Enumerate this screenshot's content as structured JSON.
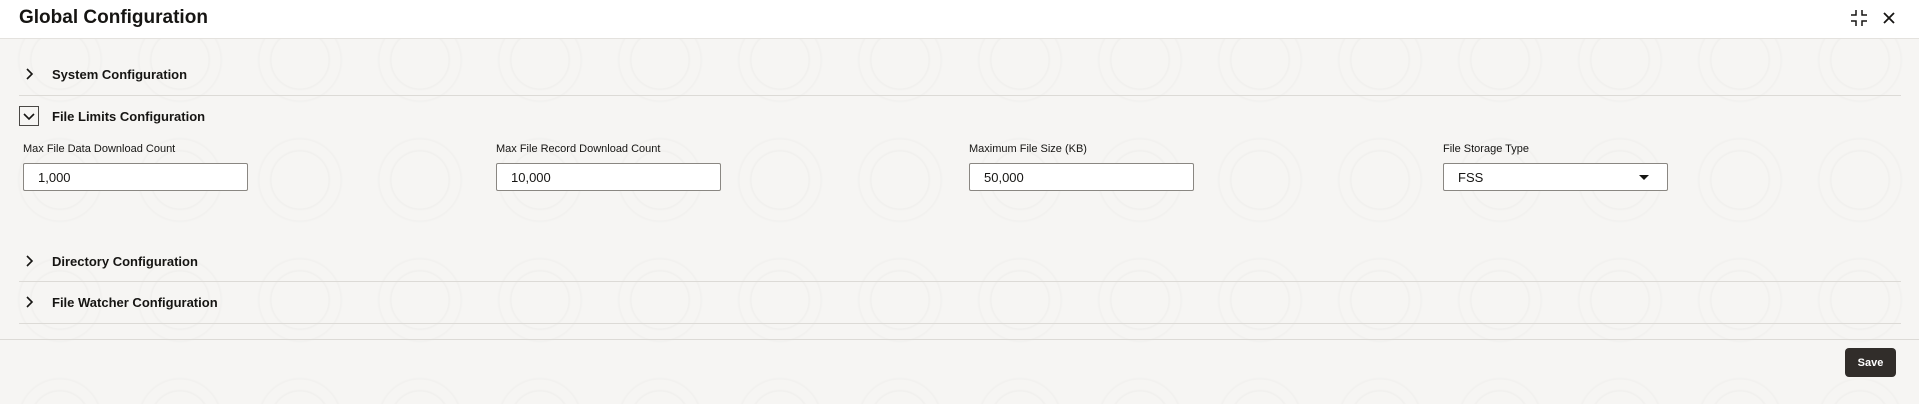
{
  "window": {
    "title": "Global Configuration",
    "icons": [
      "compress-icon",
      "close-icon"
    ]
  },
  "sections": {
    "system": {
      "title": "System Configuration",
      "expanded": false
    },
    "file_limits": {
      "title": "File Limits Configuration",
      "expanded": true,
      "fields": {
        "max_data_download": {
          "label": "Max File Data Download Count",
          "value": "1,000"
        },
        "max_record_download": {
          "label": "Max File Record Download Count",
          "value": "10,000"
        },
        "max_file_size": {
          "label": "Maximum File Size (KB)",
          "value": "50,000"
        },
        "storage_type": {
          "label": "File Storage Type",
          "value": "FSS"
        }
      }
    },
    "directory": {
      "title": "Directory Configuration",
      "expanded": false
    },
    "file_watcher": {
      "title": "File Watcher Configuration",
      "expanded": false
    }
  },
  "footer": {
    "save_label": "Save"
  },
  "colors": {
    "primary_button": "#312d2a",
    "background": "#f6f5f3"
  }
}
